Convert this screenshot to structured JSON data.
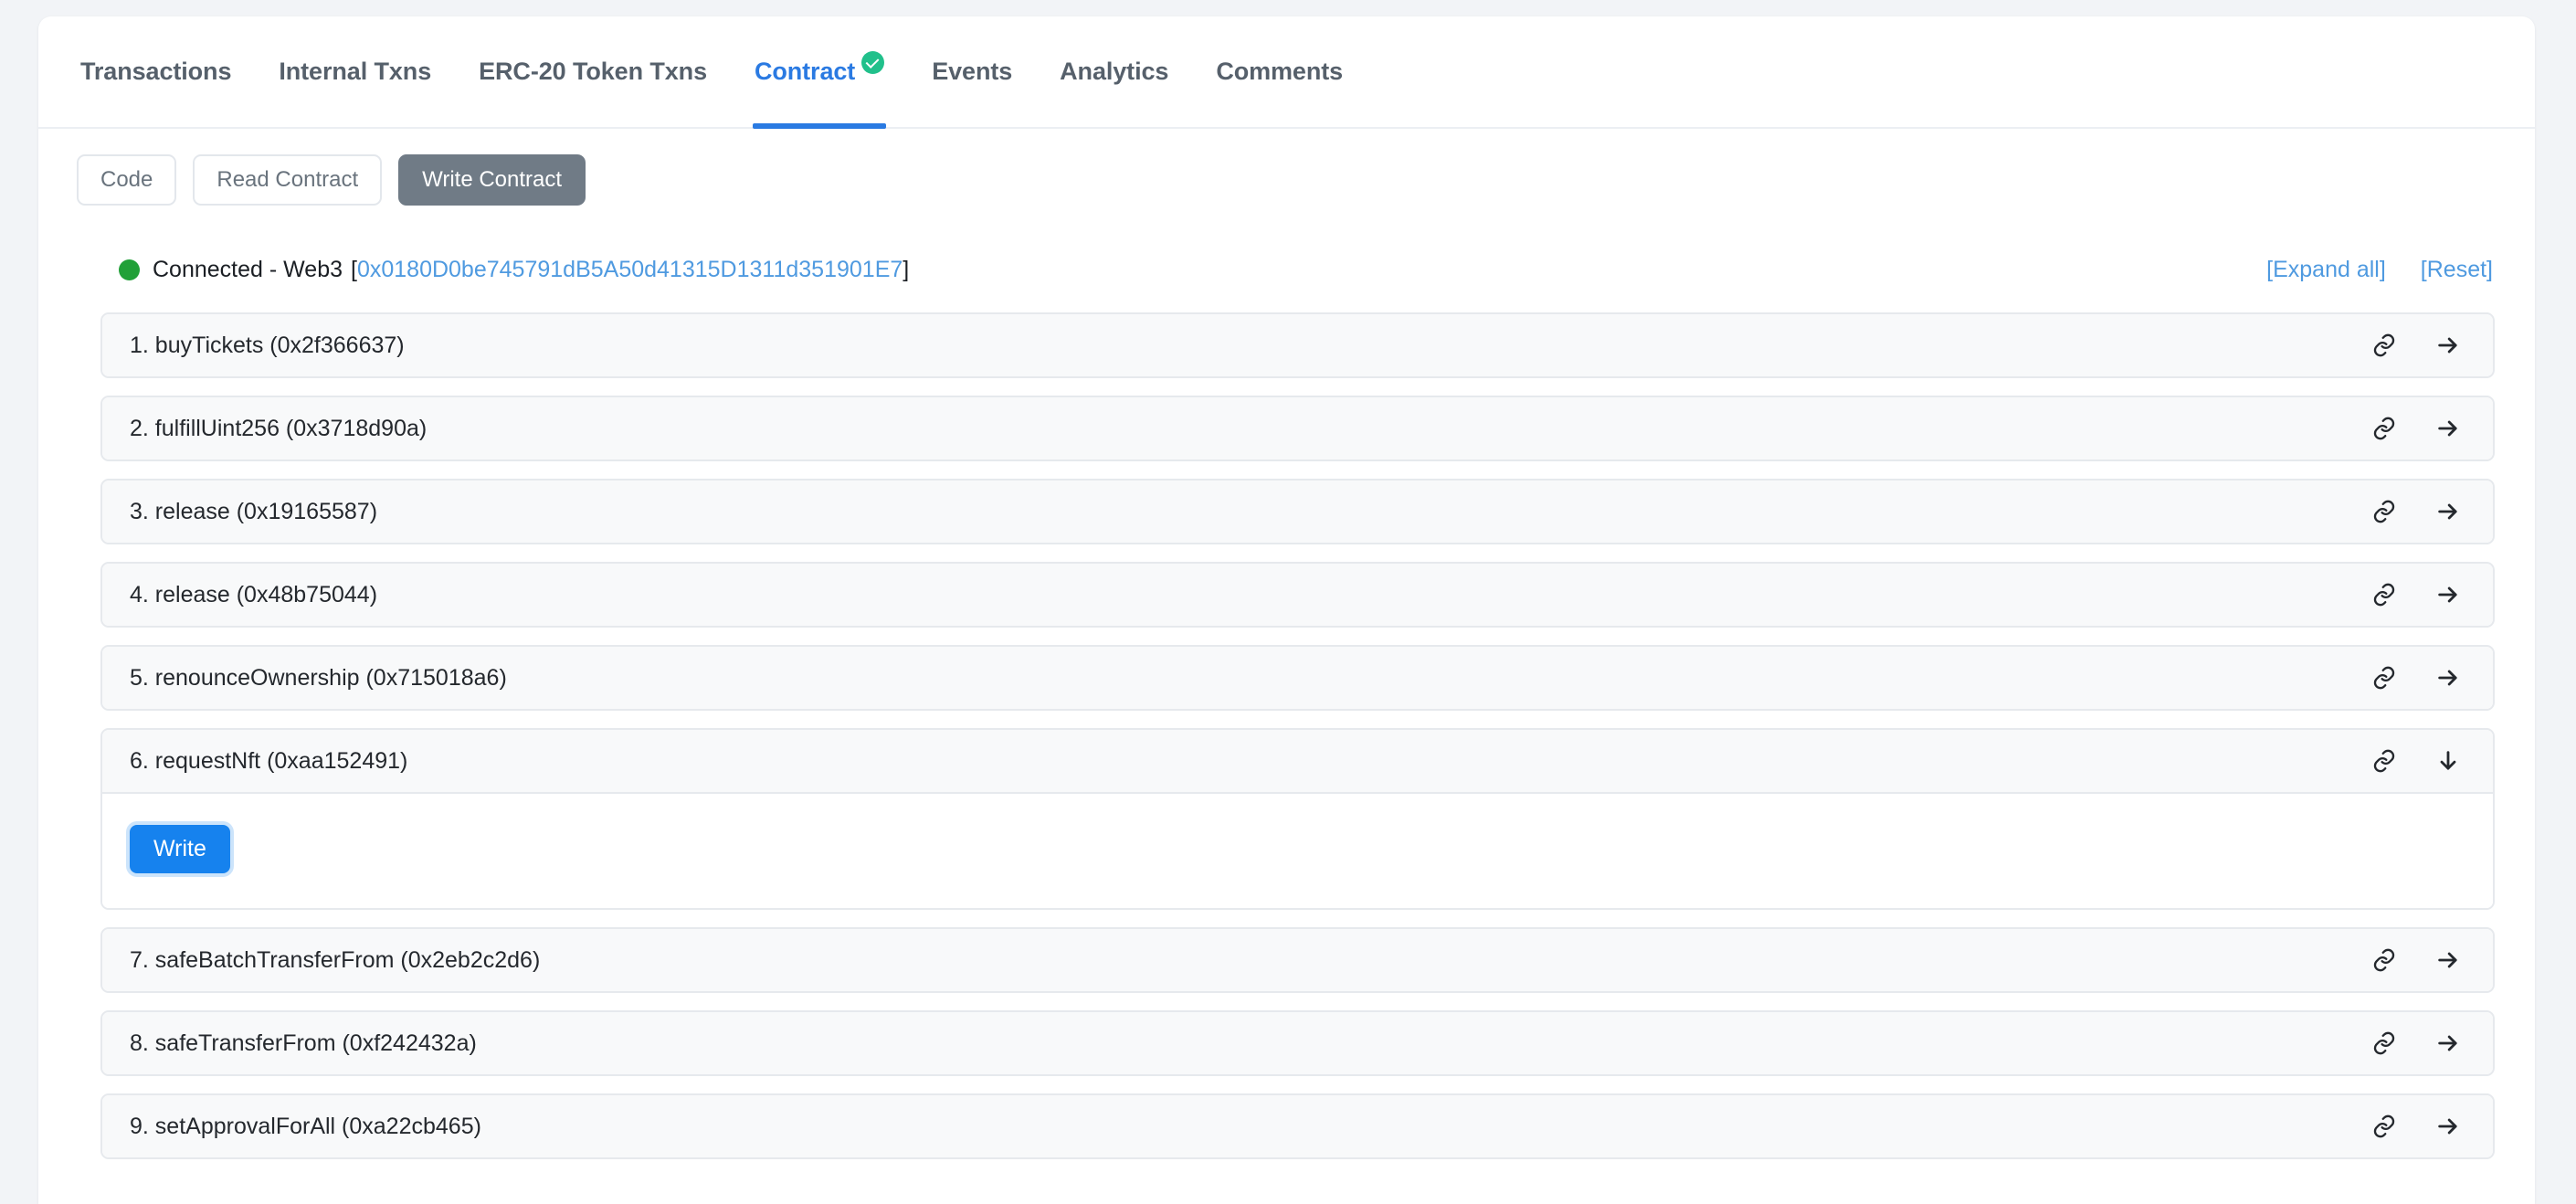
{
  "tabs": [
    {
      "label": "Transactions",
      "active": false,
      "verified": false
    },
    {
      "label": "Internal Txns",
      "active": false,
      "verified": false
    },
    {
      "label": "ERC-20 Token Txns",
      "active": false,
      "verified": false
    },
    {
      "label": "Contract",
      "active": true,
      "verified": true
    },
    {
      "label": "Events",
      "active": false,
      "verified": false
    },
    {
      "label": "Analytics",
      "active": false,
      "verified": false
    },
    {
      "label": "Comments",
      "active": false,
      "verified": false
    }
  ],
  "subbar": {
    "code_label": "Code",
    "read_label": "Read Contract",
    "write_label": "Write Contract"
  },
  "connection": {
    "status_text": "Connected - Web3",
    "bracket_open": "[",
    "address": "0x0180D0be745791dB5A50d41315D1311d351901E7",
    "bracket_close": "]",
    "expand_all_label": "[Expand all]",
    "reset_label": "[Reset]",
    "dot_color": "#21a038"
  },
  "functions": [
    {
      "title": "1. buyTickets (0x2f366637)",
      "expanded": false
    },
    {
      "title": "2. fulfillUint256 (0x3718d90a)",
      "expanded": false
    },
    {
      "title": "3. release (0x19165587)",
      "expanded": false
    },
    {
      "title": "4. release (0x48b75044)",
      "expanded": false
    },
    {
      "title": "5. renounceOwnership (0x715018a6)",
      "expanded": false
    },
    {
      "title": "6. requestNft (0xaa152491)",
      "expanded": true,
      "write_label": "Write"
    },
    {
      "title": "7. safeBatchTransferFrom (0x2eb2c2d6)",
      "expanded": false
    },
    {
      "title": "8. safeTransferFrom (0xf242432a)",
      "expanded": false
    },
    {
      "title": "9. setApprovalForAll (0xa22cb465)",
      "expanded": false
    }
  ],
  "colors": {
    "accent_blue": "#2a7ae2",
    "write_button": "#1682ee",
    "active_pill": "#707b86",
    "verified_green": "#21c08b",
    "link_blue": "#4f9ae0"
  }
}
